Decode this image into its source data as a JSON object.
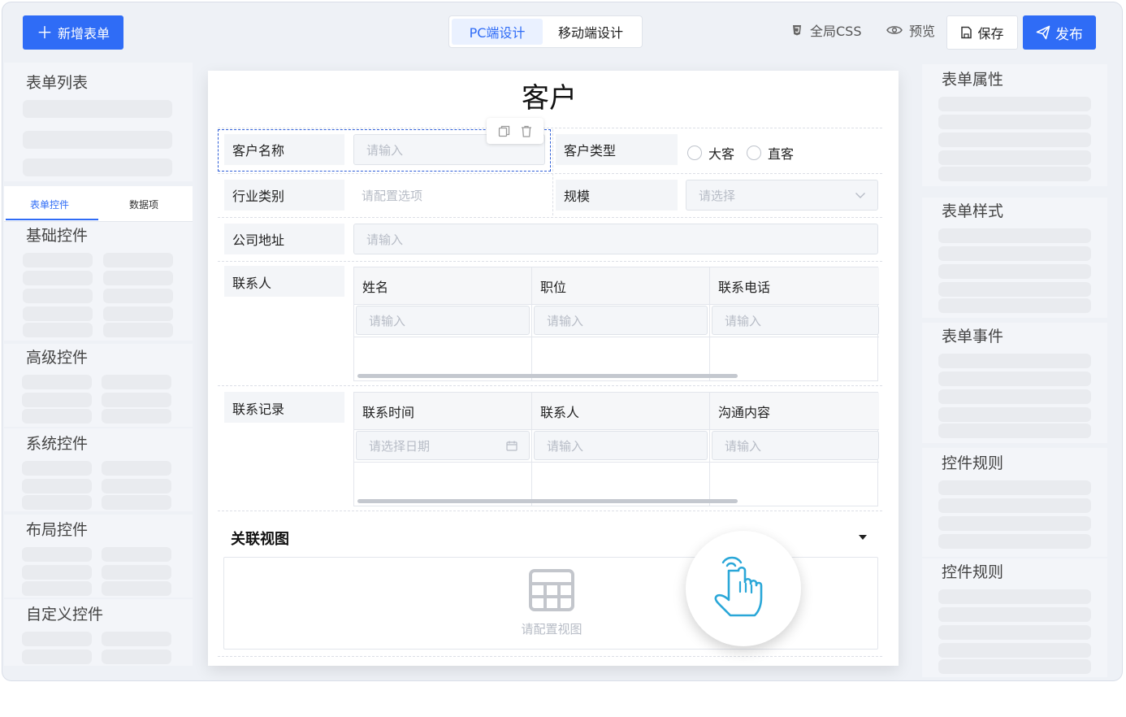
{
  "toolbar": {
    "new_form": "新增表单",
    "tab_pc": "PC端设计",
    "tab_mobile": "移动端设计",
    "global_css": "全局CSS",
    "preview": "预览",
    "save": "保存",
    "publish": "发布"
  },
  "left_panel": {
    "form_list": "表单列表",
    "tab_controls": "表单控件",
    "tab_data": "数据项",
    "basic": "基础控件",
    "advanced": "高级控件",
    "system": "系统控件",
    "layout": "布局控件",
    "custom": "自定义控件"
  },
  "form": {
    "title": "客户",
    "customer_name_label": "客户名称",
    "customer_name_placeholder": "请输入",
    "customer_type_label": "客户类型",
    "type_options": [
      "大客",
      "直客"
    ],
    "industry_label": "行业类别",
    "industry_placeholder": "请配置选项",
    "scale_label": "规模",
    "scale_placeholder": "请选择",
    "address_label": "公司地址",
    "address_placeholder": "请输入",
    "contact_label": "联系人",
    "contact_columns": [
      "姓名",
      "职位",
      "联系电话"
    ],
    "contact_placeholders": [
      "请输入",
      "请输入",
      "请输入"
    ],
    "record_label": "联系记录",
    "record_columns": [
      "联系时间",
      "联系人",
      "沟通内容"
    ],
    "record_placeholders": [
      "请选择日期",
      "请输入",
      "请输入"
    ],
    "related_view": "关联视图",
    "related_view_placeholder": "请配置视图"
  },
  "right_panel": {
    "form_props": "表单属性",
    "form_style": "表单样式",
    "form_events": "表单事件",
    "control_rules_1": "控件规则",
    "control_rules_2": "控件规则"
  },
  "colors": {
    "accent": "#2f6cf6",
    "panel": "#f3f5f9"
  }
}
